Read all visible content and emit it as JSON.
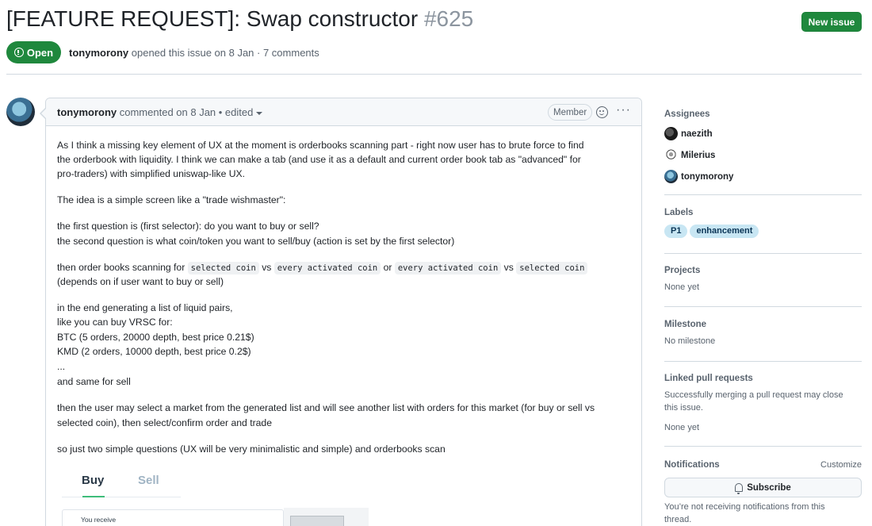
{
  "issue": {
    "title": "[FEATURE REQUEST]: Swap constructor",
    "number": "#625",
    "new_issue_label": "New issue",
    "state_label": "Open",
    "author": "tonymorony",
    "meta_text": "opened this issue on 8 Jan · 7 comments"
  },
  "comment": {
    "author": "tonymorony",
    "meta": "commented on 8 Jan • edited",
    "role_badge": "Member",
    "menu_glyph": "···",
    "lines": {
      "p1a": "As I think a missing key element of UX at the moment is orderbooks scanning part - right now user has to brute force to find",
      "p1b": "the orderbook with liquidity. I think we can make a tab (and use it as a default and current order book tab as \"advanced\" for",
      "p1c": "pro-traders) with simplified uniswap-like UX.",
      "p2": "The idea is a simple screen like a \"trade wishmaster\":",
      "p3a": "the first question is (first selector): do you want to buy or sell?",
      "p3b": "the second question is what coin/token you want to sell/buy (action is set by the first selector)",
      "p4_prefix": "then order books scanning for ",
      "p4_code1": "selected coin",
      "p4_vs1": " vs ",
      "p4_code2": "every activated coin",
      "p4_or": " or ",
      "p4_code3": "every activated coin",
      "p4_vs2": " vs ",
      "p4_code4": "selected coin",
      "p4b": "(depends on if user want to buy or sell)",
      "p5a": "in the end generating a list of liquid pairs,",
      "p5b": "like you can buy VRSC for:",
      "p5c": "BTC (5 orders, 20000 depth, best price 0.21$)",
      "p5d": "KMD (2 orders, 10000 depth, best price 0.2$)",
      "p5e": "...",
      "p5f": "and same for sell",
      "p6a": "then the user may select a market from the generated list and will see another list with orders for this market (for buy or sell vs",
      "p6b": "selected coin), then select/confirm order and trade",
      "p7": "so just two simple questions (UX will be very minimalistic and simple) and orderbooks scan"
    },
    "mockup": {
      "tab_buy": "Buy",
      "tab_sell": "Sell",
      "receive_label": "You receive"
    }
  },
  "sidebar": {
    "assignees": {
      "heading": "Assignees",
      "people": [
        "naezith",
        "Milerius",
        "tonymorony"
      ]
    },
    "labels": {
      "heading": "Labels",
      "items": [
        "P1",
        "enhancement"
      ],
      "color": "#c8e6f3"
    },
    "projects": {
      "heading": "Projects",
      "value": "None yet"
    },
    "milestone": {
      "heading": "Milestone",
      "value": "No milestone"
    },
    "linked_prs": {
      "heading": "Linked pull requests",
      "description_a": "Successfully merging a pull request may close",
      "description_b": "this issue.",
      "value": "None yet"
    },
    "notifications": {
      "heading": "Notifications",
      "customize": "Customize",
      "subscribe": "Subscribe",
      "note_a": "You’re not receiving notifications from this",
      "note_b": "thread."
    }
  },
  "colors": {
    "accent_green": "#1f883d",
    "muted_text": "#59636e",
    "border": "#d1d9e0"
  },
  "icons": [
    "issue-open-icon",
    "smiley-icon",
    "kebab-icon",
    "caret-down-icon",
    "bell-icon"
  ]
}
